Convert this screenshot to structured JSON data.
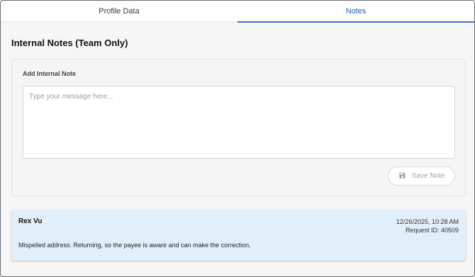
{
  "tabs": [
    {
      "label": "Profile Data",
      "active": false
    },
    {
      "label": "Notes",
      "active": true
    }
  ],
  "section": {
    "title": "Internal Notes (Team Only)"
  },
  "add_note": {
    "label": "Add Internal Note",
    "placeholder": "Type your message here...",
    "value": "",
    "save_label": "Save Note",
    "save_icon": "save-icon",
    "save_enabled": false
  },
  "notes": [
    {
      "author": "Rex Vu",
      "timestamp": "12/26/2025, 10:28 AM",
      "request_id": "Request ID: 40509",
      "body": "Mispelled address. Returning, so the payee is aware and can make the correction."
    }
  ],
  "colors": {
    "accent": "#1a5fb4",
    "note_background": "#e1effb",
    "page_background": "#f6f6f6"
  }
}
